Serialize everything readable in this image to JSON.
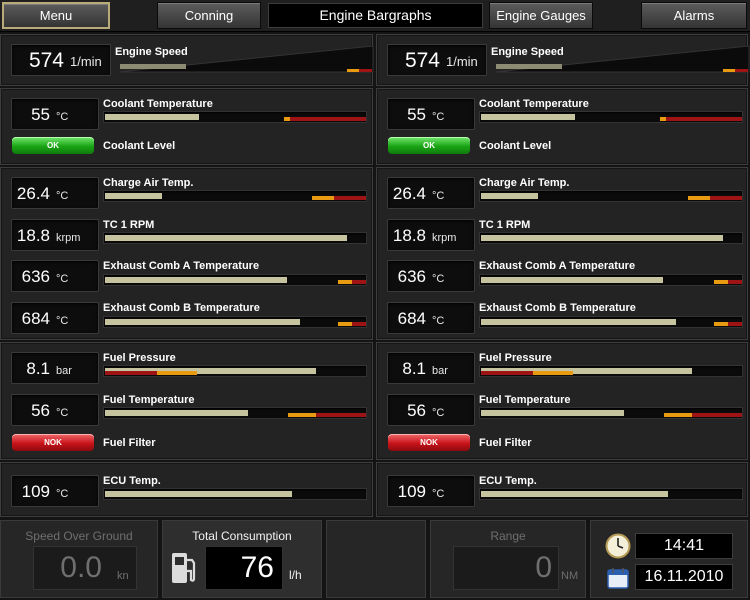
{
  "topbar": {
    "menu": "Menu",
    "conning": "Conning",
    "title": "Engine Bargraphs",
    "engine_gauges": "Engine Gauges",
    "alarms": "Alarms"
  },
  "engines": [
    {
      "speed": {
        "label": "Engine Speed",
        "value": "574",
        "unit": "1/min",
        "level": 0.26
      },
      "coolant_temp": {
        "label": "Coolant Temperature",
        "value": "55",
        "unit": "°C",
        "level": 0.36
      },
      "coolant_level": {
        "label": "Coolant Level",
        "status": "OK"
      },
      "charge_air": {
        "label": "Charge Air Temp.",
        "value": "26.4",
        "unit": "°C",
        "level": 0.22
      },
      "tc_rpm": {
        "label": "TC 1 RPM",
        "value": "18.8",
        "unit": "krpm",
        "level": 0.93
      },
      "exhaust_a": {
        "label": "Exhaust Comb A Temperature",
        "value": "636",
        "unit": "°C",
        "level": 0.7
      },
      "exhaust_b": {
        "label": "Exhaust Comb B Temperature",
        "value": "684",
        "unit": "°C",
        "level": 0.75
      },
      "fuel_pressure": {
        "label": "Fuel Pressure",
        "value": "8.1",
        "unit": "bar",
        "level": 0.81
      },
      "fuel_temp": {
        "label": "Fuel Temperature",
        "value": "56",
        "unit": "°C",
        "level": 0.55
      },
      "fuel_filter": {
        "label": "Fuel Filter",
        "status": "NOK"
      },
      "ecu_temp": {
        "label": "ECU Temp.",
        "value": "109",
        "unit": "°C",
        "level": 0.72
      }
    },
    {
      "speed": {
        "label": "Engine Speed",
        "value": "574",
        "unit": "1/min",
        "level": 0.26
      },
      "coolant_temp": {
        "label": "Coolant Temperature",
        "value": "55",
        "unit": "°C",
        "level": 0.36
      },
      "coolant_level": {
        "label": "Coolant Level",
        "status": "OK"
      },
      "charge_air": {
        "label": "Charge Air Temp.",
        "value": "26.4",
        "unit": "°C",
        "level": 0.22
      },
      "tc_rpm": {
        "label": "TC 1 RPM",
        "value": "18.8",
        "unit": "krpm",
        "level": 0.93
      },
      "exhaust_a": {
        "label": "Exhaust Comb A Temperature",
        "value": "636",
        "unit": "°C",
        "level": 0.7
      },
      "exhaust_b": {
        "label": "Exhaust Comb B Temperature",
        "value": "684",
        "unit": "°C",
        "level": 0.75
      },
      "fuel_pressure": {
        "label": "Fuel Pressure",
        "value": "8.1",
        "unit": "bar",
        "level": 0.81
      },
      "fuel_temp": {
        "label": "Fuel Temperature",
        "value": "56",
        "unit": "°C",
        "level": 0.55
      },
      "fuel_filter": {
        "label": "Fuel Filter",
        "status": "NOK"
      },
      "ecu_temp": {
        "label": "ECU Temp.",
        "value": "109",
        "unit": "°C",
        "level": 0.72
      }
    }
  ],
  "bottom": {
    "sog": {
      "label": "Speed Over Ground",
      "value": "0.0",
      "unit": "kn"
    },
    "consumption": {
      "label": "Total Consumption",
      "value": "76",
      "unit": "l/h",
      "icon": "fuel-pump-icon"
    },
    "range": {
      "label": "Range",
      "value": "0",
      "unit": "NM"
    },
    "clock": {
      "time": "14:41",
      "date": "16.11.2010",
      "time_icon": "clock-icon",
      "date_icon": "calendar-icon"
    }
  },
  "colors": {
    "ok": "#19a414",
    "nok": "#c8141a",
    "warn": "#e89a10",
    "alarm": "#9e1414",
    "bar": "#c6c39f"
  }
}
